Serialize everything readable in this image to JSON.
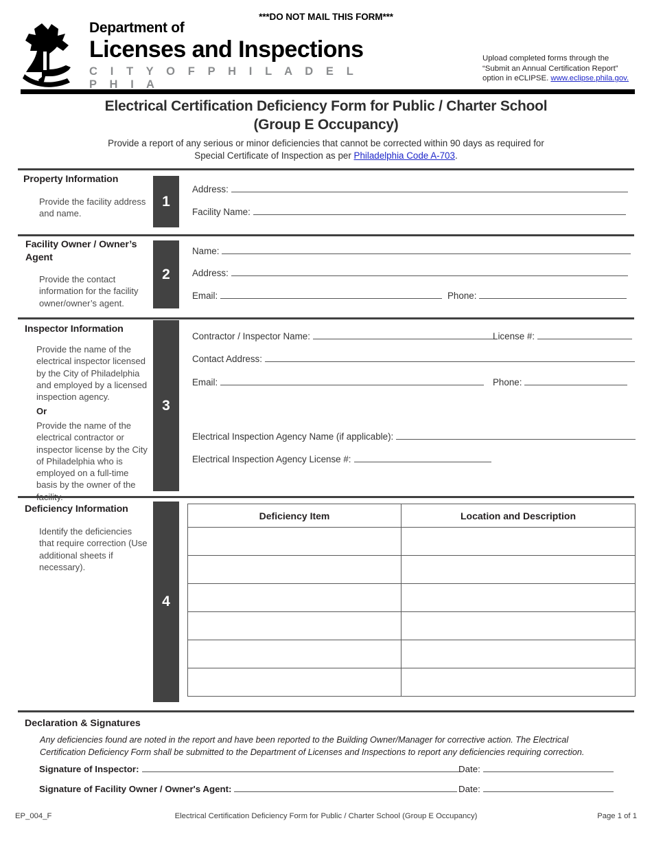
{
  "header": {
    "do_not_mail": "***DO NOT MAIL THIS FORM***",
    "logo": {
      "icon": "liberty-bell-icon",
      "line1": "Department of",
      "line2": "Licenses and Inspections",
      "line3": "C I T Y   O F   P H I L A D E L P H I A"
    },
    "upload_note": {
      "line1": "Upload completed forms through the",
      "line2": "“Submit an Annual Certification Report”",
      "line3_prefix": "option in eCLIPSE. ",
      "link_text": "www.eclipse.phila.gov."
    }
  },
  "title": {
    "line1": "Electrical Certification Deficiency Form for Public / Charter School",
    "line2": "(Group E Occupancy)",
    "subtitle_line1": "Provide a report of any serious or minor deficiencies that cannot be corrected within 90 days as required for",
    "subtitle_line2_prefix": "Special Certificate of Inspection as per ",
    "subtitle_link": "Philadelphia Code A-703",
    "subtitle_line2_suffix": "."
  },
  "sections": [
    {
      "number": "1",
      "heading": "Property Information",
      "description": "Provide the facility address and name.",
      "fields": [
        {
          "label": "Address:"
        },
        {
          "label": "Facility Name:"
        }
      ]
    },
    {
      "number": "2",
      "heading": "Facility Owner / Owner’s Agent",
      "description": "Provide the contact information for the facility owner/owner’s agent.",
      "fields": [
        {
          "label": "Name:"
        },
        {
          "label": "Address:"
        },
        {
          "label": "Email:"
        },
        {
          "label": "Phone:"
        }
      ]
    },
    {
      "number": "3",
      "heading": "Inspector Information",
      "description_1": "Provide the name of the electrical inspector licensed by the City of Philadelphia and employed by a licensed inspection agency.",
      "description_or": "Or",
      "description_2": "Provide the name of the electrical contractor or inspector license by the City of Philadelphia who is employed on a full-time basis by the owner of the facility.",
      "fields": [
        {
          "label": "Contractor / Inspector Name:"
        },
        {
          "label": "License #:"
        },
        {
          "label": "Contact Address:"
        },
        {
          "label": "Email:"
        },
        {
          "label": "Phone:"
        },
        {
          "label": "Electrical Inspection Agency Name (if applicable):"
        },
        {
          "label": "Electrical Inspection Agency License #:"
        }
      ]
    },
    {
      "number": "4",
      "heading": "Deficiency Information",
      "description": "Identify the deficiencies that require correction (Use additional sheets if necessary)."
    }
  ],
  "deficiency_table": {
    "columns": [
      "Deficiency Item",
      "Location and Description"
    ],
    "rows": [
      [
        "",
        ""
      ],
      [
        "",
        ""
      ],
      [
        "",
        ""
      ],
      [
        "",
        ""
      ],
      [
        "",
        ""
      ],
      [
        "",
        ""
      ]
    ]
  },
  "declaration": {
    "heading": "Declaration & Signatures",
    "body": "Any deficiencies found are noted in the report and have been reported to the Building Owner/Manager for corrective action. The Electrical Certification Deficiency Form shall be submitted to the Department of Licenses and Inspections to report any deficiencies requiring correction.",
    "signature_inspector_label": "Signature of Inspector:",
    "signature_owner_label": "Signature of Facility Owner / Owner's Agent:",
    "date_label_1": "Date:",
    "date_label_2": "Date:"
  },
  "footer": {
    "form_id": "EP_004_F",
    "center": "Electrical Certification Deficiency Form for Public / Charter School (Group E Occupancy)",
    "page": "Page 1 of 1"
  }
}
